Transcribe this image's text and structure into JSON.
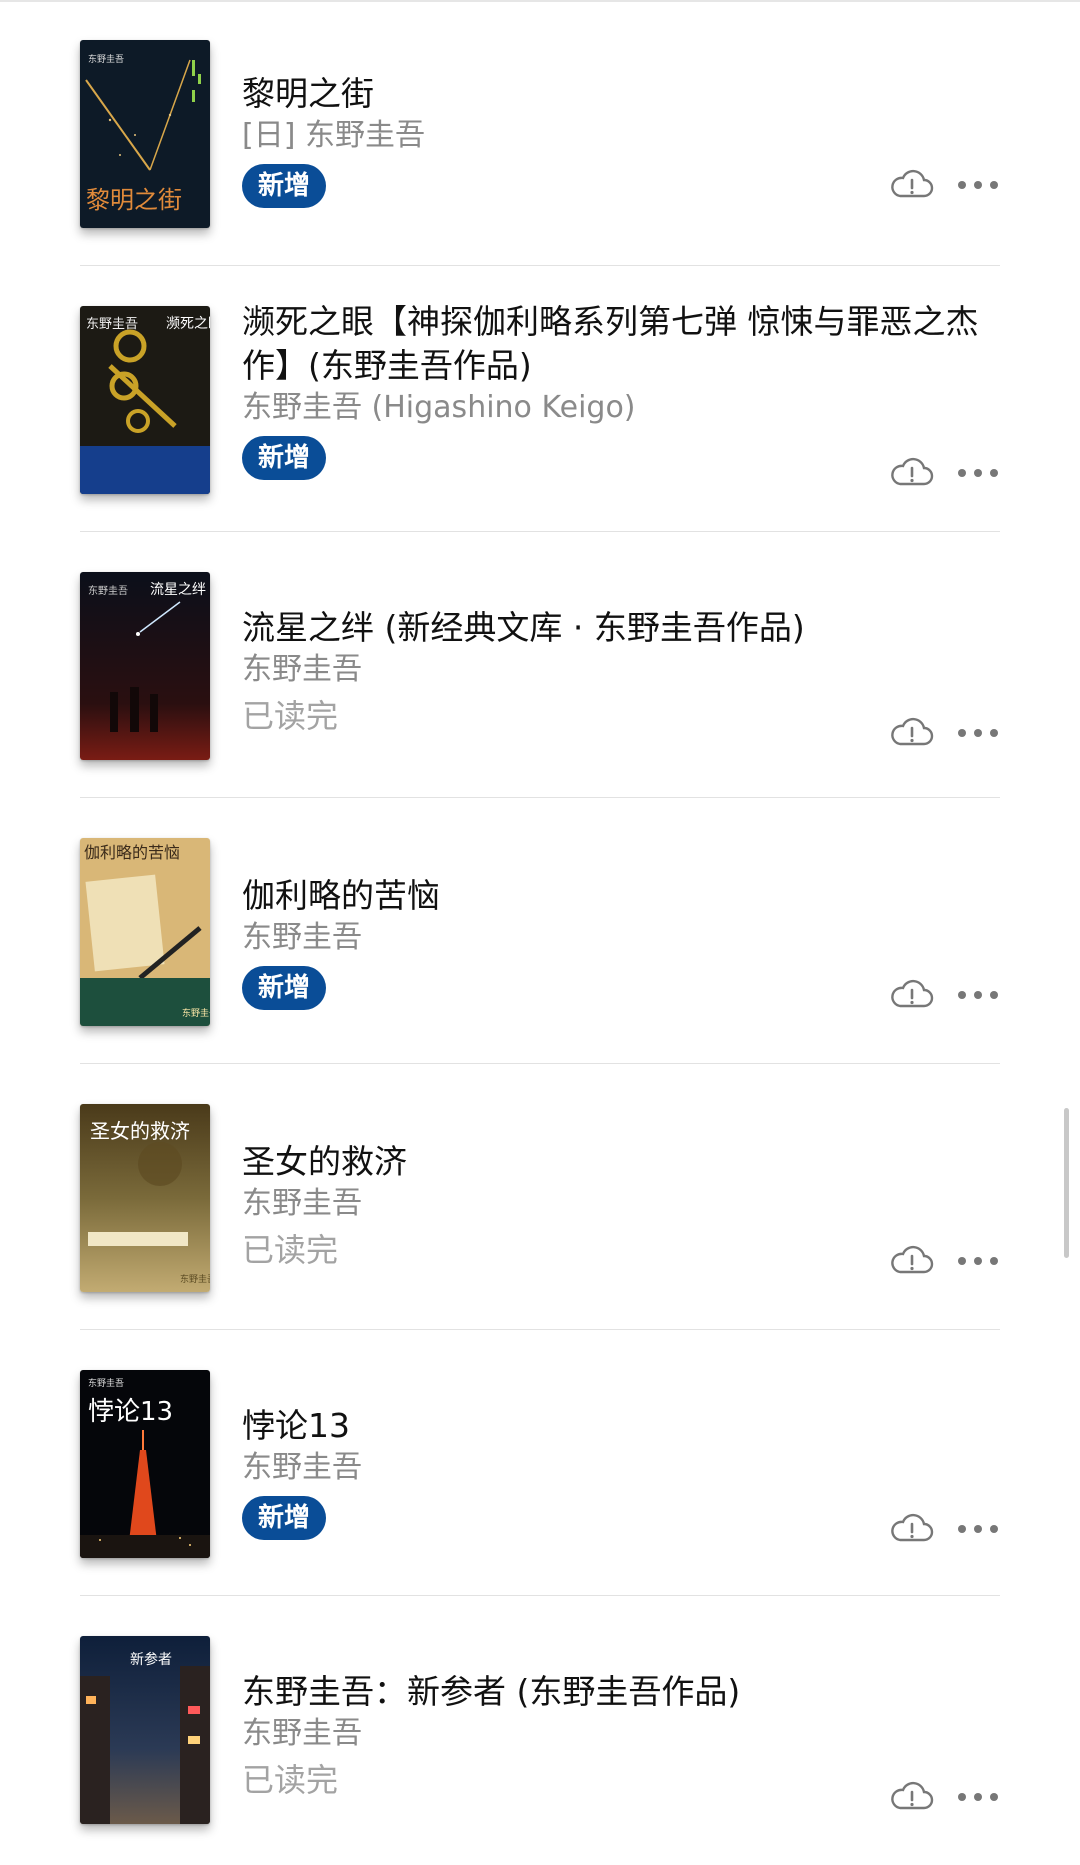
{
  "books": [
    {
      "title": "黎明之街",
      "author": "[日] 东野圭吾",
      "badge": "新增",
      "status": ""
    },
    {
      "title": "濒死之眼【神探伽利略系列第七弹 惊悚与罪恶之杰作】(东野圭吾作品)",
      "author": "东野圭吾 (Higashino Keigo)",
      "badge": "新增",
      "status": ""
    },
    {
      "title": "流星之绊 (新经典文库 · 东野圭吾作品)",
      "author": "东野圭吾",
      "badge": "",
      "status": "已读完"
    },
    {
      "title": "伽利略的苦恼",
      "author": "东野圭吾",
      "badge": "新增",
      "status": ""
    },
    {
      "title": "圣女的救济",
      "author": "东野圭吾",
      "badge": "",
      "status": "已读完"
    },
    {
      "title": "悖论13",
      "author": "东野圭吾",
      "badge": "新增",
      "status": ""
    },
    {
      "title": "东野圭吾：新参者 (东野圭吾作品)",
      "author": "东野圭吾",
      "badge": "",
      "status": "已读完"
    }
  ],
  "covers": [
    {
      "author_text": "东野圭吾",
      "title_text": "黎明之街"
    },
    {
      "author_text": "东野圭吾",
      "title_text": "濒死之眼"
    },
    {
      "author_text": "东野圭吾",
      "title_text": "流星之绊"
    },
    {
      "author_text": "东野圭吾",
      "title_text": "伽利略的苦恼"
    },
    {
      "author_text": "东野圭吾",
      "title_text": "圣女的救济"
    },
    {
      "author_text": "东野圭吾",
      "title_text": "悖论13"
    },
    {
      "author_text": "",
      "title_text": "新参者"
    }
  ],
  "icons": {
    "cloud": "cloud-warning-icon",
    "more": "more-dots-icon"
  },
  "colors": {
    "badge_bg": "#0a4d97",
    "title": "#111111",
    "secondary": "#8a8a8a",
    "read": "#a3a3a3"
  }
}
